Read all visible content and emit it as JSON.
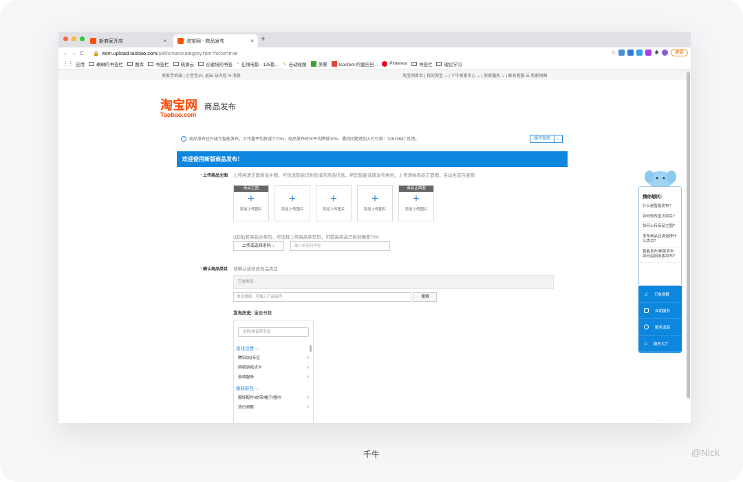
{
  "browser": {
    "tabs": [
      {
        "label": "新商家开店",
        "active": false
      },
      {
        "label": "淘宝网 - 商品发布",
        "active": true
      }
    ],
    "new_tab": "+",
    "url_domain": "item.upload.taobao.com",
    "url_path": "/sell/smart/category.htm?force=true",
    "update_label": "更新",
    "bookmarks": [
      "应用",
      "琳琳的书签栏",
      "图库",
      "书签栏",
      "晓源云",
      "谷建培的书签",
      "在线电影 - 125影...",
      "自动绘图",
      "美餐",
      "Iconfont-阿里巴巴...",
      "Pinterest",
      "书签栏",
      "理论学习"
    ]
  },
  "site": {
    "topbar_left": "卖家手机端 | 小音音10, 退出  站内信  ✉ 消息",
    "topbar_right": "淘宝网首页 | 我的淘宝 ⌄ | 千牛卖家中心 ⌄ | 卖家服务 ⌄ | 联系客服  ☰ 卖家地图",
    "logo_cn": "淘宝网",
    "logo_en": "Taobao.com",
    "page_title": "商品发布",
    "notice": "商品发布已升级为智能发布，工作量平均将减少70%，商品发布时长平均降低30%。遇到问题请加入钉钉群：32619647 反馈。",
    "guide_button": "操作指南",
    "banner": "欢迎使用新版商品发布！"
  },
  "form": {
    "main_image_label": "上传商品主图",
    "main_image_hint": "上传高清正面商品主图，可快速智能识别及填充商品信息，帮您智能选择发布类目，上传清晰商品正面图，自动生成白底图",
    "upload_boxes": [
      {
        "tag": "商品主图",
        "label": "添加上传图片"
      },
      {
        "tag": "",
        "label": "添加上传图片"
      },
      {
        "tag": "",
        "label": "添加上传图片"
      },
      {
        "tag": "",
        "label": "添加上传图片"
      },
      {
        "tag": "商品正面图",
        "label": "添加上传图片"
      }
    ],
    "barcode_hint": "(选填)若商品含条码，可选择上传商品条形码，可提高商品识别准确率70%",
    "barcode_select": "上传或选择条码 ⌵",
    "barcode_placeholder": "输入条形码内容",
    "category_label": "确认商品类目",
    "category_hint": "请确认或修改商品类目",
    "selected_category": "已选类目:",
    "category_search_placeholder": "类目搜索：可输入产品名称",
    "search_button": "搜索",
    "history_label": "发布历史:",
    "history_value": "漫画书籍",
    "cat_search_placeholder": "名称/拼音首字母",
    "groups": [
      {
        "name": "游戏话费 ⌵",
        "items": [
          "腾讯QQ专区",
          "网络游戏点卡",
          "游戏服务"
        ]
      },
      {
        "name": "服装鞋包 ⌵",
        "items": [
          "服饰配件/皮带/帽子/围巾",
          "流行男鞋"
        ]
      }
    ]
  },
  "widget": {
    "title": "猜你想问:",
    "questions": [
      "什么是智能发布?",
      "如何修改宝贝类目?",
      "如何上传商品主图?",
      "发布商品应该选择什么类目?",
      "智能发布/新版发布如何返回旧版发布?"
    ],
    "services": [
      "万象提醒",
      "自助服务",
      "服务追踪",
      "服务大厅"
    ]
  },
  "caption": "千牛",
  "credit": "@Nick"
}
